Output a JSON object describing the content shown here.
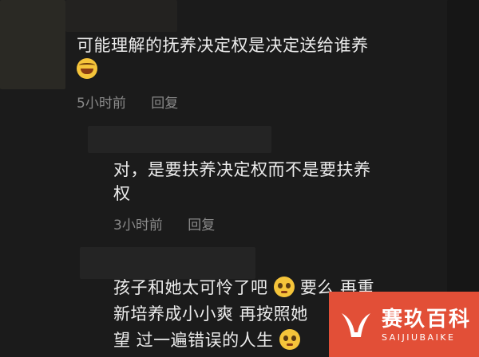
{
  "comments": [
    {
      "text": "可能理解的抚养决定权是决定送给谁养",
      "time": "5小时前",
      "reply_label": "回复",
      "emoji": "laughing-face-icon"
    },
    {
      "text_line1": "对，是要扶养决定权而不是要扶养",
      "text_line2": "权",
      "time": "3小时前",
      "reply_label": "回复"
    },
    {
      "line1": "孩子和她太可怜了吧",
      "line1b": "要么 再重",
      "line2": "新培养成小小爽 再按照她",
      "line3": "望 过一遍错误的人生",
      "emoji": "pleading-face-icon"
    }
  ],
  "watermark": {
    "cn": "赛玖百科",
    "en": "SAIJIUBAIKE",
    "color": "#e24f37"
  }
}
